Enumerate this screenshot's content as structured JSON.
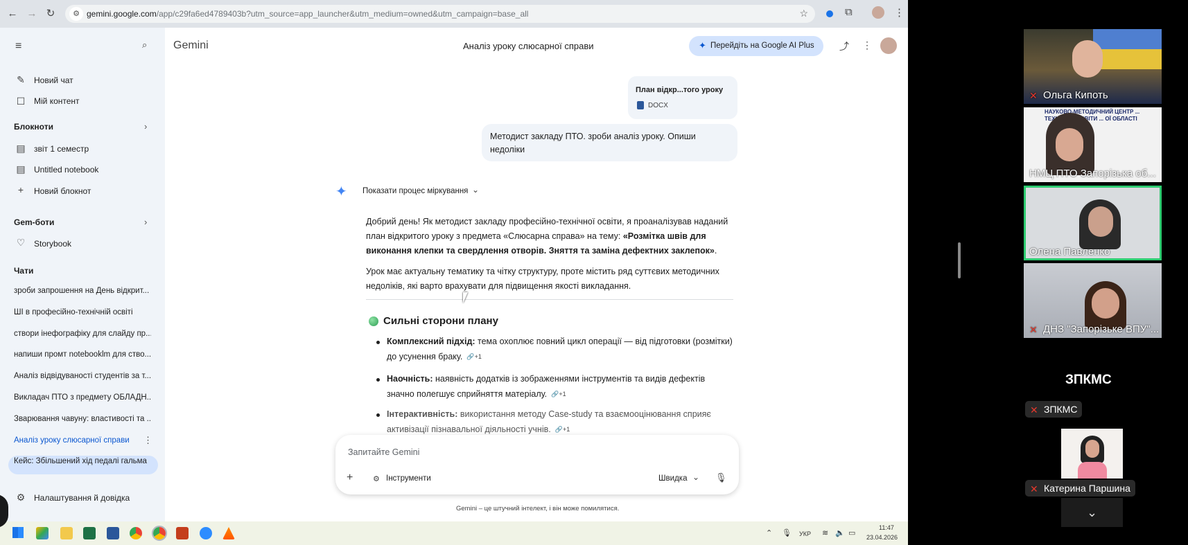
{
  "browser": {
    "url_domain": "gemini.google.com",
    "url_rest": "/app/c29fa6ed4789403b?utm_source=app_launcher&utm_medium=owned&utm_campaign=base_all"
  },
  "gemini": {
    "brand": "Gemini",
    "chat_title": "Аналіз уроку слюсарної справи",
    "upgrade_label": "Перейдіть на Google AI Plus",
    "sidebar": {
      "new_chat": "Новий чат",
      "my_content": "Мій контент",
      "notebooks_header": "Блокноти",
      "notebooks": [
        "звіт 1 семестр",
        "Untitled notebook"
      ],
      "new_notebook": "Новий блокнот",
      "gems_header": "Gem-боти",
      "storybook": "Storybook",
      "chats_header": "Чати",
      "chats": [
        "зроби запрошення на День відкрит...",
        "ШІ в професійно-технічній освіті",
        "створи інефографіку для слайду пр...",
        "напиши промт notebooklm для ство...",
        "Аналіз відвідуваності студентів за т...",
        "Викладач ПТО з предмету ОБЛАДН...",
        "Зварювання чавуну: властивості та ...",
        "Аналіз уроку слюсарної справи",
        "Кейс: Збільшений хід педалі гальма"
      ],
      "settings": "Налаштування й довідка"
    },
    "attachment": {
      "name": "План відкр...того уроку",
      "type": "DOCX"
    },
    "user_message": "Методист закладу ПТО. зроби аналіз уроку. Опиши недоліки",
    "show_reasoning": "Показати процес міркування",
    "response": {
      "intro_plain": "Добрий день! Як методист закладу професійно-технічної освіти, я проаналізував наданий план відкритого уроку з предмета «Слюсарна справа» на тему: ",
      "intro_bold": "«Розмітка швів для виконання клепки та свердлення отворів. Зняття та заміна дефектних заклепок»",
      "intro_end": ".",
      "second": "Урок має актуальну тематику та чітку структуру, проте містить ряд суттєвих методичних недоліків, які варто врахувати для підвищення якості викладання.",
      "section_title": "Сильні сторони плану",
      "items": [
        {
          "bold": "Комплексний підхід:",
          "text": " тема охоплює повний цикл операції — від підготовки (розмітки) до усунення браку.",
          "cite": "+1"
        },
        {
          "bold": "Наочність:",
          "text": " наявність додатків із зображеннями інструментів та видів дефектів значно полегшує сприйняття матеріалу.",
          "cite": "+1"
        },
        {
          "bold": "Інтерактивність:",
          "text": " використання методу Case-study та взаємооцінювання сприяє активізації пізнавальної діяльності учнів.",
          "cite": "+1"
        }
      ]
    },
    "input_placeholder": "Запитайте Gemini",
    "tools_label": "Інструменти",
    "mode_label": "Швидка",
    "disclaimer": "Gemini – це штучний інтелект, і він може помилятися."
  },
  "taskbar": {
    "lang": "УКР",
    "time": "11:47",
    "date": "23.04.2026"
  },
  "participants": [
    {
      "name": "Ольга Кипоть",
      "muted": true
    },
    {
      "name": "НМЦ ПТО Запорізька об...",
      "muted": false
    },
    {
      "name": "Олена Павленко",
      "muted": false
    },
    {
      "name": "ДНЗ \"Запорізьке ВПУ\"...",
      "muted": true
    }
  ],
  "banner_text": "НАУКОВО-МЕТОДИЧНИЙ ЦЕНТР ... ТЕХНІЧНОЇ ОСВІТИ ... ОЇ ОБЛАСТІ",
  "zpkms_title": "ЗПКМС",
  "zpkms_chip": "ЗПКМС",
  "kateryna_name": "Катерина Паршина",
  "colors": {
    "active_speaker": "#2ecc71",
    "accent": "#0b57d0",
    "sidebar_bg": "#f0f4f9"
  }
}
